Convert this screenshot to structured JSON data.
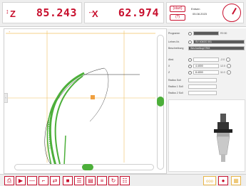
{
  "header": {
    "axis_z": {
      "letter": "Z",
      "value": "85.243"
    },
    "axis_x": {
      "letter": "X",
      "value": "62.974"
    },
    "btn_top": "(start)",
    "btn_bottom": "(?)",
    "user_label": "Entsen",
    "date": "05.08.2023"
  },
  "panel": {
    "rows": [
      {
        "label": "Programm",
        "value": "",
        "extra": "R9 80"
      },
      {
        "label": "Lehrer-Nr.",
        "value": "SV 4040G 001"
      },
      {
        "label": "Beschreibung",
        "value": "Wechselkopf R63"
      },
      {
        "label": "Abst.",
        "value": "",
        "unit": "-2.0"
      },
      {
        "label": "X",
        "value": "4.4000",
        "unit": "12.0"
      },
      {
        "label": "Z",
        "value": "8.4000",
        "unit": "11.0"
      },
      {
        "label": "Radius Soll",
        "value": ""
      },
      {
        "label": "Radius 1 Soll",
        "value": ""
      },
      {
        "label": "Radius 2 Soll",
        "value": ""
      }
    ]
  },
  "toolbar": {
    "left_icons": [
      "print-icon",
      "play-icon",
      "minus-icon",
      "contour-icon",
      "swap-icon",
      "save-icon",
      "list-icon",
      "doc-icon",
      "menu-icon",
      "rotate-icon",
      "list-edit-icon"
    ],
    "right_icons": [
      "ooo-icon",
      "pin-icon",
      "grid-icon"
    ]
  },
  "colors": {
    "accent": "#c8102e",
    "path": "#4caf3a",
    "guide": "#f0c060"
  }
}
